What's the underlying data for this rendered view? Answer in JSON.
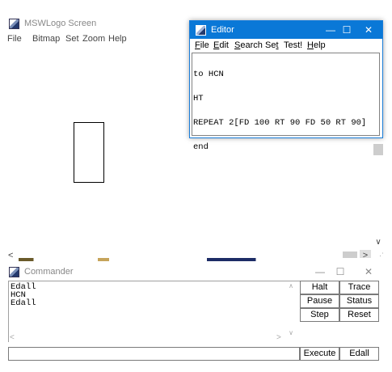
{
  "main_window": {
    "title": "MSWLogo Screen",
    "menu": [
      "File",
      "Bitmap",
      "Set",
      "Zoom",
      "Help"
    ]
  },
  "editor": {
    "title": "Editor",
    "controls": {
      "minimize": "—",
      "maximize": "☐",
      "close": "✕"
    },
    "menu": [
      {
        "ul": "F",
        "rest": "ile"
      },
      {
        "ul": "E",
        "rest": "dit"
      },
      {
        "ul": "S",
        "rest": "earch"
      },
      {
        "pre": "Se",
        "ul": "t",
        "rest": ""
      },
      {
        "pre": "Test!",
        "ul": "",
        "rest": ""
      },
      {
        "ul": "H",
        "rest": "elp"
      }
    ],
    "code_lines": [
      "to HCN",
      "HT",
      "REPEAT 2[FD 100 RT 90 FD 50 RT 90]",
      "end"
    ]
  },
  "commander": {
    "title": "Commander",
    "controls": {
      "minimize": "—",
      "maximize": "☐",
      "close": "✕"
    },
    "history": [
      "Edall",
      "HCN",
      "Edall"
    ],
    "input_value": "",
    "buttons": {
      "halt": "Halt",
      "trace": "Trace",
      "pause": "Pause",
      "status": "Status",
      "step": "Step",
      "reset": "Reset",
      "execute": "Execute",
      "edall": "Edall"
    }
  },
  "icons": {
    "scroll_left": "<",
    "scroll_right": ">",
    "scroll_down": "∨",
    "scroll_up": "∧"
  }
}
